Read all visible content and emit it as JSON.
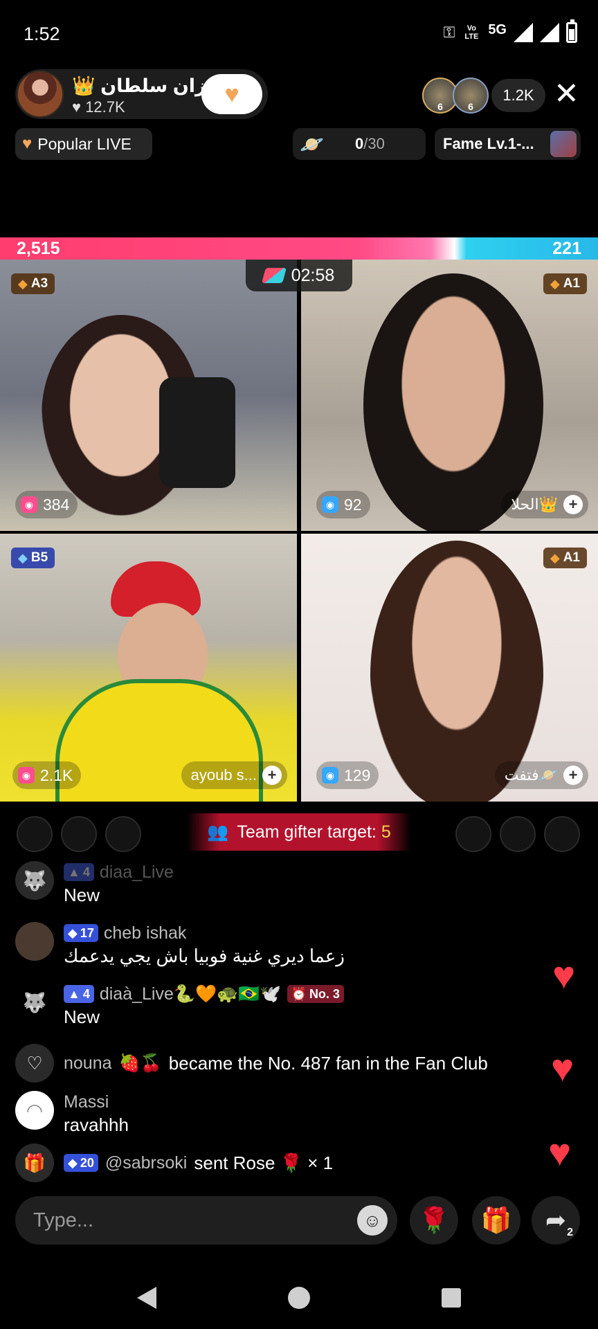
{
  "status_bar": {
    "time": "1:52",
    "network": "5G",
    "lte_label": "Vo LTE"
  },
  "host": {
    "name": "رزان سلطان",
    "crown": "👑",
    "likes": "12.7K",
    "follow_icon": "heart-follow-icon"
  },
  "viewers": {
    "top_viewer_badges": [
      "6",
      "6"
    ],
    "count": "1.2K"
  },
  "info_pills": {
    "popular_label": "Popular LIVE",
    "progress_current": "0",
    "progress_total": "/30",
    "fame_label": "Fame Lv.1-..."
  },
  "battle": {
    "score_left": "2,515",
    "score_right": "221",
    "timer": "02:58",
    "colors": {
      "left": "#ff3d6e",
      "right": "#27b8e8"
    }
  },
  "tiles": [
    {
      "rank": "A3",
      "fans": "384",
      "name": ""
    },
    {
      "rank": "A1",
      "fans": "92",
      "name": "الحلا👑"
    },
    {
      "rank": "B5",
      "fans": "2.1K",
      "name": "ayoub s..."
    },
    {
      "rank": "A1",
      "fans": "129",
      "name": "فتفت🪐"
    }
  ],
  "team_gifter": {
    "label": "Team gifter target: ",
    "target": "5"
  },
  "chat": [
    {
      "level": "4",
      "user": "diaa_Live",
      "text": "New"
    },
    {
      "level": "17",
      "user": "cheb ishak",
      "text": "زعما ديري غنية فوبيا باش يجي يدعمك"
    },
    {
      "level": "4",
      "user": "diaà_Live🐍🧡🐢🇧🇷🕊️",
      "badge": "No. 3",
      "text": "New"
    },
    {
      "user": "nouna",
      "emojis": "🍓🍒",
      "text": "became the No. 487 fan in the Fan Club"
    },
    {
      "user": "Massi",
      "text": "ravahhh"
    },
    {
      "level": "20",
      "user": "@sabrsoki",
      "text": "sent Rose 🌹 × 1"
    }
  ],
  "input": {
    "placeholder": "Type...",
    "share_count": "2"
  }
}
